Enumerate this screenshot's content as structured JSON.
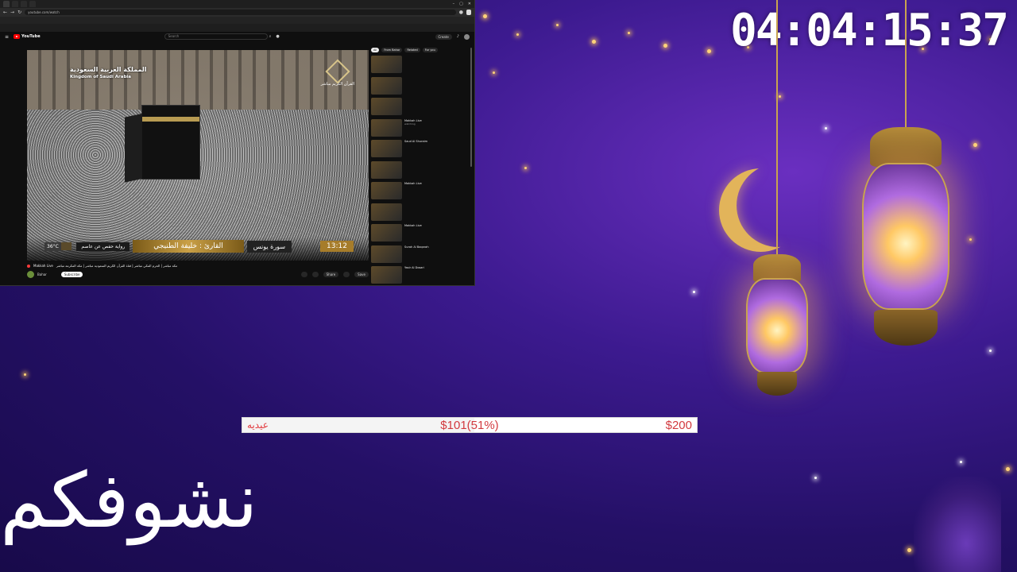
{
  "countdown": "04:04:15:37",
  "browser": {
    "tabs": [
      "",
      "",
      "",
      ""
    ],
    "url": "youtube.com/watch",
    "info_button": "",
    "bookmarks": [],
    "infobar_text": ""
  },
  "youtube": {
    "logo": "YouTube",
    "search_placeholder": "Search",
    "create_label": "Create",
    "video": {
      "overlay_title_ar": "المملكة العربية السعودية",
      "overlay_title_en": "Kingdom of Saudi Arabia",
      "channel_logo_text": "القرآن الكريم مباشر",
      "temperature": "36°C",
      "riwaya": "رواية حفص عن عاصم",
      "qari": "القارئ : خليفة الطنيجي",
      "surah": "سورة يونس",
      "time": "13:12"
    },
    "meta": {
      "title": "مكة مباشر | الحرم المكي مباشر | قناة القرآن الكريم السعودية مباشر | مكة المكرمة مباشر",
      "live_label": "Makkah Live",
      "channel": "Bahar",
      "subscribers": "",
      "subscribe_label": "Subscribe",
      "actions": [
        "",
        "",
        "Share",
        "",
        "Save"
      ]
    },
    "sidebar": {
      "chips": [
        "All",
        "From Bahar",
        "Related",
        "For you"
      ],
      "items": [
        {
          "title": "",
          "sub": ""
        },
        {
          "title": "",
          "sub": ""
        },
        {
          "title": "",
          "sub": ""
        },
        {
          "title": "Makkah Live",
          "sub": "watching"
        },
        {
          "title": "Saud Al Shuraim",
          "sub": ""
        },
        {
          "title": "",
          "sub": ""
        },
        {
          "title": "Makkah Live",
          "sub": ""
        },
        {
          "title": "",
          "sub": ""
        },
        {
          "title": "Makkah Live",
          "sub": ""
        },
        {
          "title": "Surah Al Baqarah",
          "sub": ""
        },
        {
          "title": "Yasir Al Dosari",
          "sub": ""
        },
        {
          "title": "Surah Al Baqarah",
          "sub": ""
        }
      ]
    }
  },
  "goal": {
    "label": "عيديه",
    "current": "$101(51%)",
    "target": "$200",
    "progress": 0.51
  },
  "farewell": "نشوفكم",
  "colors": {
    "background": "#241066",
    "goal_text": "#d23a3f",
    "gold": "#c9a34f"
  }
}
